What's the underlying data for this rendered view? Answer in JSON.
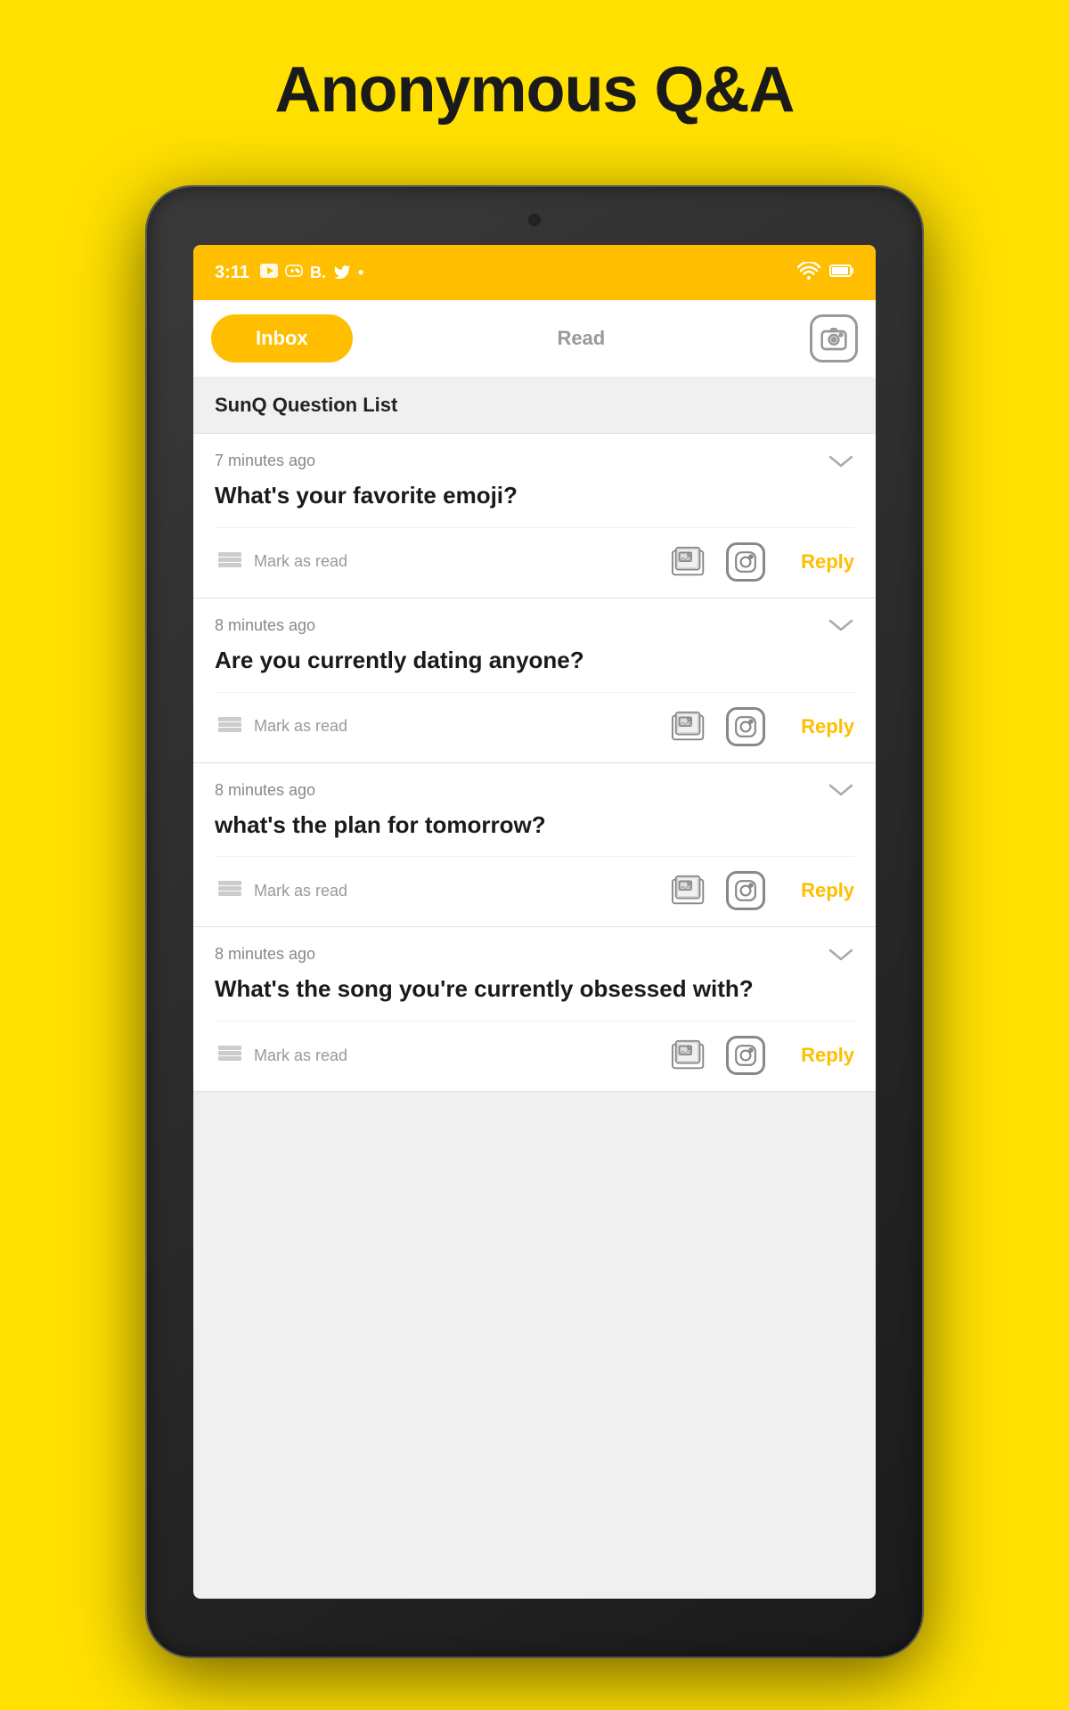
{
  "page": {
    "title": "Anonymous Q&A",
    "background_color": "#FFE000"
  },
  "status_bar": {
    "time": "3:11",
    "icons": [
      "youtube-icon",
      "game-icon",
      "b-icon",
      "twitter-icon",
      "more-icon"
    ],
    "wifi": "wifi-icon",
    "battery": "battery-icon",
    "bg_color": "#FFBE00"
  },
  "nav": {
    "inbox_label": "Inbox",
    "read_label": "Read",
    "inbox_active": true
  },
  "section": {
    "title": "SunQ Question List"
  },
  "questions": [
    {
      "id": 1,
      "time": "7 minutes ago",
      "text": "What's your favorite emoji?",
      "mark_read": "Mark as read",
      "reply": "Reply"
    },
    {
      "id": 2,
      "time": "8 minutes ago",
      "text": "Are you currently dating anyone?",
      "mark_read": "Mark as read",
      "reply": "Reply"
    },
    {
      "id": 3,
      "time": "8 minutes ago",
      "text": "what's the plan for tomorrow?",
      "mark_read": "Mark as read",
      "reply": "Reply"
    },
    {
      "id": 4,
      "time": "8 minutes ago",
      "text": "What's the song you're currently obsessed with?",
      "mark_read": "Mark as read",
      "reply": "Reply"
    }
  ],
  "colors": {
    "accent": "#FFBE00",
    "text_primary": "#1a1a1a",
    "text_secondary": "#888",
    "icon_color": "#888",
    "reply_color": "#FFBE00"
  }
}
